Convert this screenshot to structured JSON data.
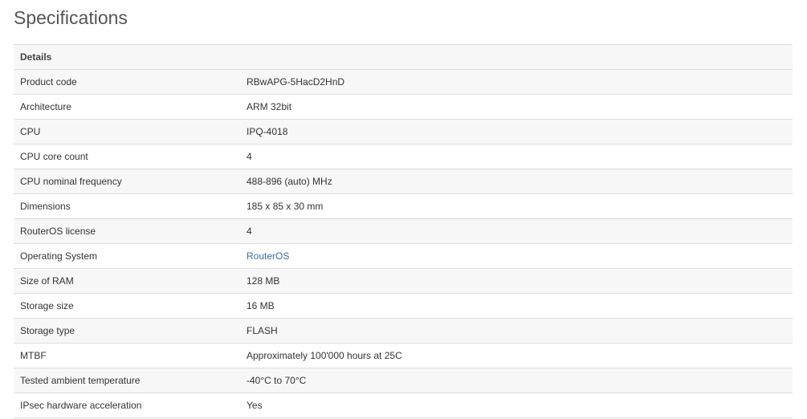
{
  "heading": "Specifications",
  "section_header": "Details",
  "link_color": "#3a6ea5",
  "rows": [
    {
      "label": "Product code",
      "value": "RBwAPG-5HacD2HnD"
    },
    {
      "label": "Architecture",
      "value": "ARM 32bit"
    },
    {
      "label": "CPU",
      "value": "IPQ-4018"
    },
    {
      "label": "CPU core count",
      "value": "4"
    },
    {
      "label": "CPU nominal frequency",
      "value": "488-896 (auto) MHz"
    },
    {
      "label": "Dimensions",
      "value": "185 x 85 x 30 mm"
    },
    {
      "label": "RouterOS license",
      "value": "4"
    },
    {
      "label": "Operating System",
      "value": "RouterOS"
    },
    {
      "label": "Size of RAM",
      "value": "128 MB"
    },
    {
      "label": "Storage size",
      "value": "16 MB"
    },
    {
      "label": "Storage type",
      "value": "FLASH"
    },
    {
      "label": "MTBF",
      "value": "Approximately 100'000 hours at 25C"
    },
    {
      "label": "Tested ambient temperature",
      "value": "-40°C to 70°C"
    },
    {
      "label": "IPsec hardware acceleration",
      "value": "Yes"
    }
  ]
}
